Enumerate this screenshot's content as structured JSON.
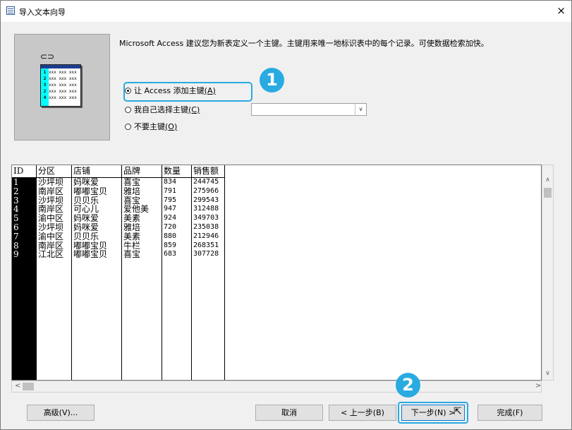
{
  "window": {
    "title": "导入文本向导",
    "close": "×"
  },
  "description": "Microsoft Access 建议您为新表定义一个主键。主键用来唯一地标识表中的每个记录。可使数据检索加快。",
  "preview": {
    "key_glyph": "⊂⊃",
    "rows": [
      {
        "n": "1",
        "t": "xxx xxx xxx"
      },
      {
        "n": "2",
        "t": "xxx xxx xxx"
      },
      {
        "n": "3",
        "t": "xxx xxx xxx"
      },
      {
        "n": "2",
        "t": "xxx xxx xxx"
      },
      {
        "n": "4",
        "t": "xxx xxx xxx"
      }
    ]
  },
  "options": {
    "add_key": {
      "label": "让 Access 添加主键",
      "hotkey": "(A)"
    },
    "choose_key": {
      "label": "我自己选择主键",
      "hotkey": "(C)"
    },
    "no_key": {
      "label": "不要主键",
      "hotkey": "(O)"
    },
    "choose_key_value": ""
  },
  "badges": {
    "one": "1",
    "two": "2"
  },
  "table": {
    "headers": [
      "ID",
      "分区",
      "店铺",
      "品牌",
      "数量",
      "销售额"
    ],
    "ids": [
      "1",
      "2",
      "3",
      "4",
      "5",
      "6",
      "7",
      "8",
      "9"
    ],
    "districts": [
      "沙坪坝",
      "南岸区",
      "沙坪坝",
      "南岸区",
      "渝中区",
      "沙坪坝",
      "渝中区",
      "南岸区",
      "江北区"
    ],
    "stores": [
      "妈咪爱",
      "嘟嘟宝贝",
      "贝贝乐",
      "可心儿",
      "妈咪爱",
      "妈咪爱",
      "贝贝乐",
      "嘟嘟宝贝",
      "嘟嘟宝贝"
    ],
    "brands": [
      "喜宝",
      "雅培",
      "喜宝",
      "爱他美",
      "美素",
      "雅培",
      "美素",
      "牛栏",
      "喜宝"
    ],
    "quantities": [
      "834",
      "791",
      "795",
      "947",
      "924",
      "720",
      "880",
      "859",
      "683"
    ],
    "sales": [
      "244745",
      "275966",
      "299543",
      "312488",
      "349703",
      "235038",
      "212946",
      "268351",
      "307728"
    ]
  },
  "buttons": {
    "advanced": "高级(V)...",
    "cancel": "取消",
    "back": "< 上一步(B)",
    "next": "下一步(N) >",
    "finish": "完成(F)"
  },
  "icons": [
    "table-icon",
    "close-icon",
    "key-icon",
    "scroll-up-icon",
    "scroll-down-icon",
    "scroll-left-icon",
    "scroll-right-icon",
    "mouse-cursor-icon"
  ],
  "colors": {
    "highlight": "#29abe2",
    "focus": "#0078d7"
  }
}
